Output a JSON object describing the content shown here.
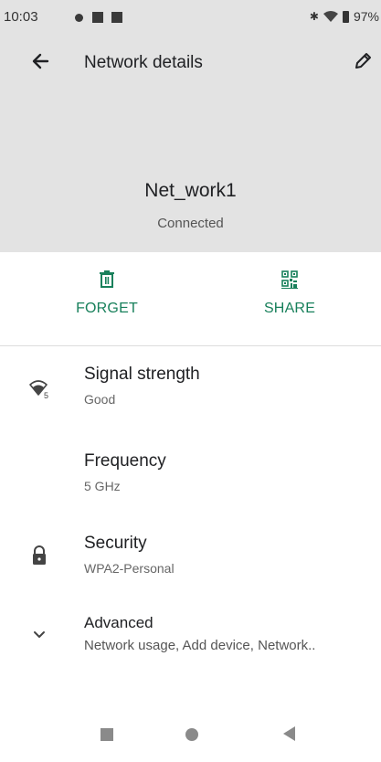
{
  "status_bar": {
    "time": "10:03",
    "battery": "97%"
  },
  "app_bar": {
    "title": "Network details",
    "back_icon": "arrow-left-icon",
    "edit_icon": "pencil-icon"
  },
  "network": {
    "name": "Net_work1",
    "status": "Connected"
  },
  "actions": [
    {
      "label": "FORGET",
      "icon": "trash-icon"
    },
    {
      "label": "SHARE",
      "icon": "qr-code-icon"
    }
  ],
  "details": [
    {
      "title": "Signal strength",
      "subtitle": "Good",
      "icon": "wifi-5-icon"
    },
    {
      "title": "Frequency",
      "subtitle": "5 GHz",
      "icon": ""
    },
    {
      "title": "Security",
      "subtitle": "WPA2-Personal",
      "icon": "lock-icon"
    },
    {
      "title": "Advanced",
      "subtitle": "Network usage, Add device, Network..",
      "icon": "chevron-down-icon"
    }
  ],
  "colors": {
    "header_bg": "#e3e3e3",
    "accent": "#18805b",
    "text_primary": "#202124",
    "text_secondary": "#666666"
  },
  "wifi_badge": "5",
  "navigation": {
    "buttons": [
      "recents",
      "home",
      "back"
    ]
  }
}
